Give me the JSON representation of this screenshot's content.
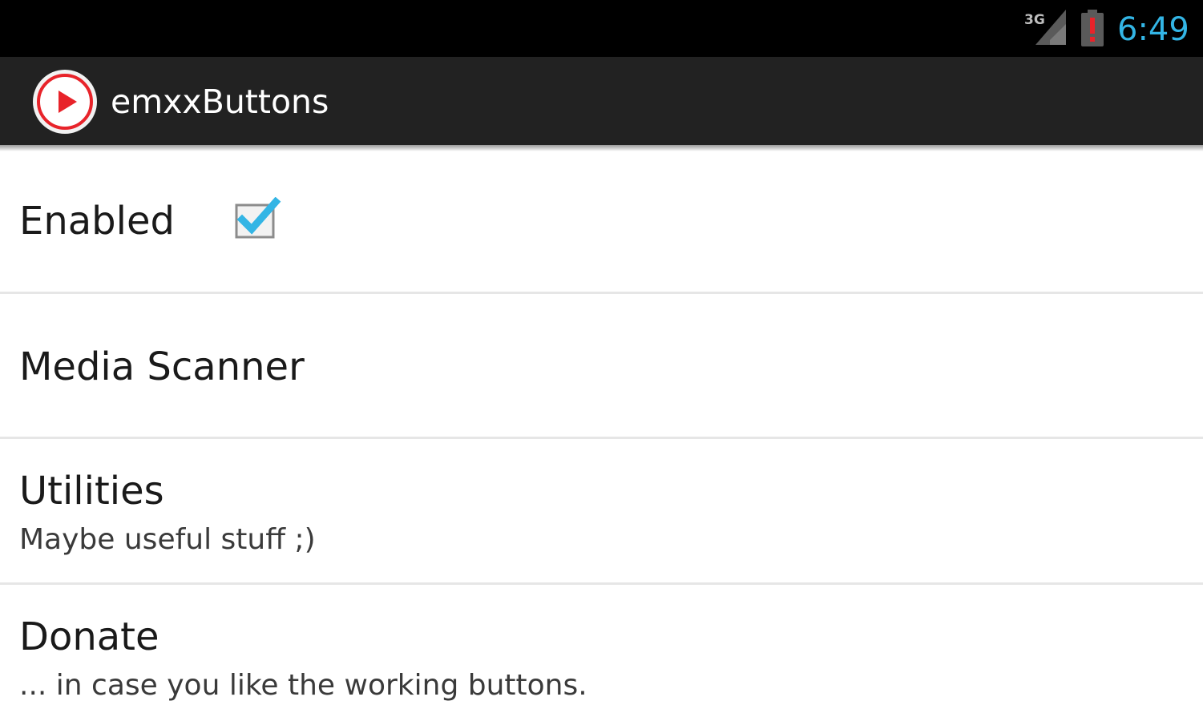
{
  "status_bar": {
    "network_label": "3G",
    "time": "6:49",
    "icons": [
      "signal-3g-icon",
      "battery-alert-icon"
    ],
    "time_color": "#33b5e5"
  },
  "action_bar": {
    "title": "emxxButtons",
    "icon": "app-play-icon",
    "background": "#222222"
  },
  "preferences": [
    {
      "title": "Enabled",
      "summary": "",
      "widget": "checkbox",
      "checked": true
    },
    {
      "title": "Media Scanner",
      "summary": ""
    },
    {
      "title": "Utilities",
      "summary": "Maybe useful stuff ;)"
    },
    {
      "title": "Donate",
      "summary": "... in case you like the working buttons."
    }
  ],
  "colors": {
    "accent": "#33b5e5",
    "app_icon_red": "#e8232a"
  }
}
